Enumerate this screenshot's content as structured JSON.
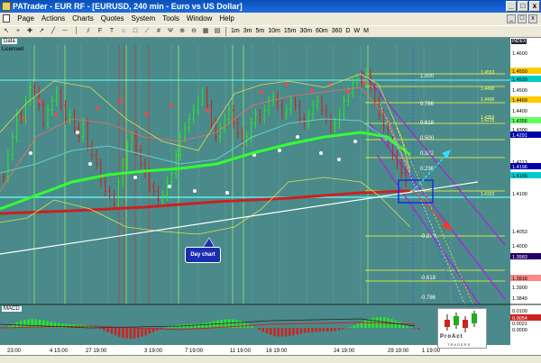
{
  "window": {
    "title": "PATrader - EUR RF - [EURUSD, 240 min - Euro vs US Dollar]",
    "min_label": "_",
    "max_label": "□",
    "close_label": "x"
  },
  "menu": [
    "Page",
    "Actions",
    "Charts",
    "Quotes",
    "System",
    "Tools",
    "Window",
    "Help"
  ],
  "mdi_buttons": [
    "_",
    "□",
    "x"
  ],
  "toolbar": {
    "tools": [
      "arrow-icon",
      "crosshair-icon",
      "plus-icon",
      "cursor-icon",
      "trendline-icon",
      "hline-icon",
      "vline-icon",
      "channel-icon",
      "fibo-icon",
      "text-icon",
      "ellipse-icon",
      "rect-icon",
      "fan-icon",
      "gann-icon",
      "pitchfork-icon",
      "zoomin-icon",
      "zoomout-icon",
      "grid-icon",
      "print-icon"
    ],
    "timeframes": [
      "1m",
      "3m",
      "5m",
      "10m",
      "15m",
      "30m",
      "60m",
      "360",
      "D",
      "W",
      "M"
    ]
  },
  "chart": {
    "panel_label": "Data",
    "sub_label": "Licensed",
    "index_label": "INDEX",
    "macd_label": "MACD",
    "callout": "Day chart",
    "logo_top": "ProAct",
    "logo_bottom": "TRADERS",
    "price_axis": [
      "1.4600",
      "1.4550",
      "1.4530",
      "1.4500",
      "1.4469",
      "1.4400",
      "1.4356",
      "1.4300",
      "1.4291",
      "1.4213",
      "1.4196",
      "1.4156",
      "1.4100",
      "1.4053",
      "1.4000",
      "1.3983",
      "1.3918",
      "1.3900",
      "1.3849"
    ],
    "macd_axis": [
      "0.0100",
      "0.0054",
      "0.0021",
      "0.0000"
    ],
    "time_axis": [
      "23:00",
      "4 15:00",
      "27 19:00",
      "3 19:00",
      "7 19:00",
      "11 19:00",
      "16 19:00",
      "24 19:00",
      "29 19:00",
      "1 19:00"
    ],
    "fib_labels": [
      "1.000",
      "0.786",
      "0.618",
      "0.500",
      "0.382",
      "0.236",
      "-0.270",
      "-0.618",
      "-0.786"
    ],
    "fib_side_labels": [
      "1.4553",
      "1.4468",
      "1.4406",
      "1.4353",
      "1.4215",
      "1.4153"
    ],
    "colors": {
      "bg": "#4a8a8a",
      "bull": "#22ee22",
      "bear": "#cc2222",
      "ma_green": "#33ff33",
      "ma_red": "#cc2020",
      "fib": "#ffff33",
      "channel": "#9933cc"
    }
  }
}
